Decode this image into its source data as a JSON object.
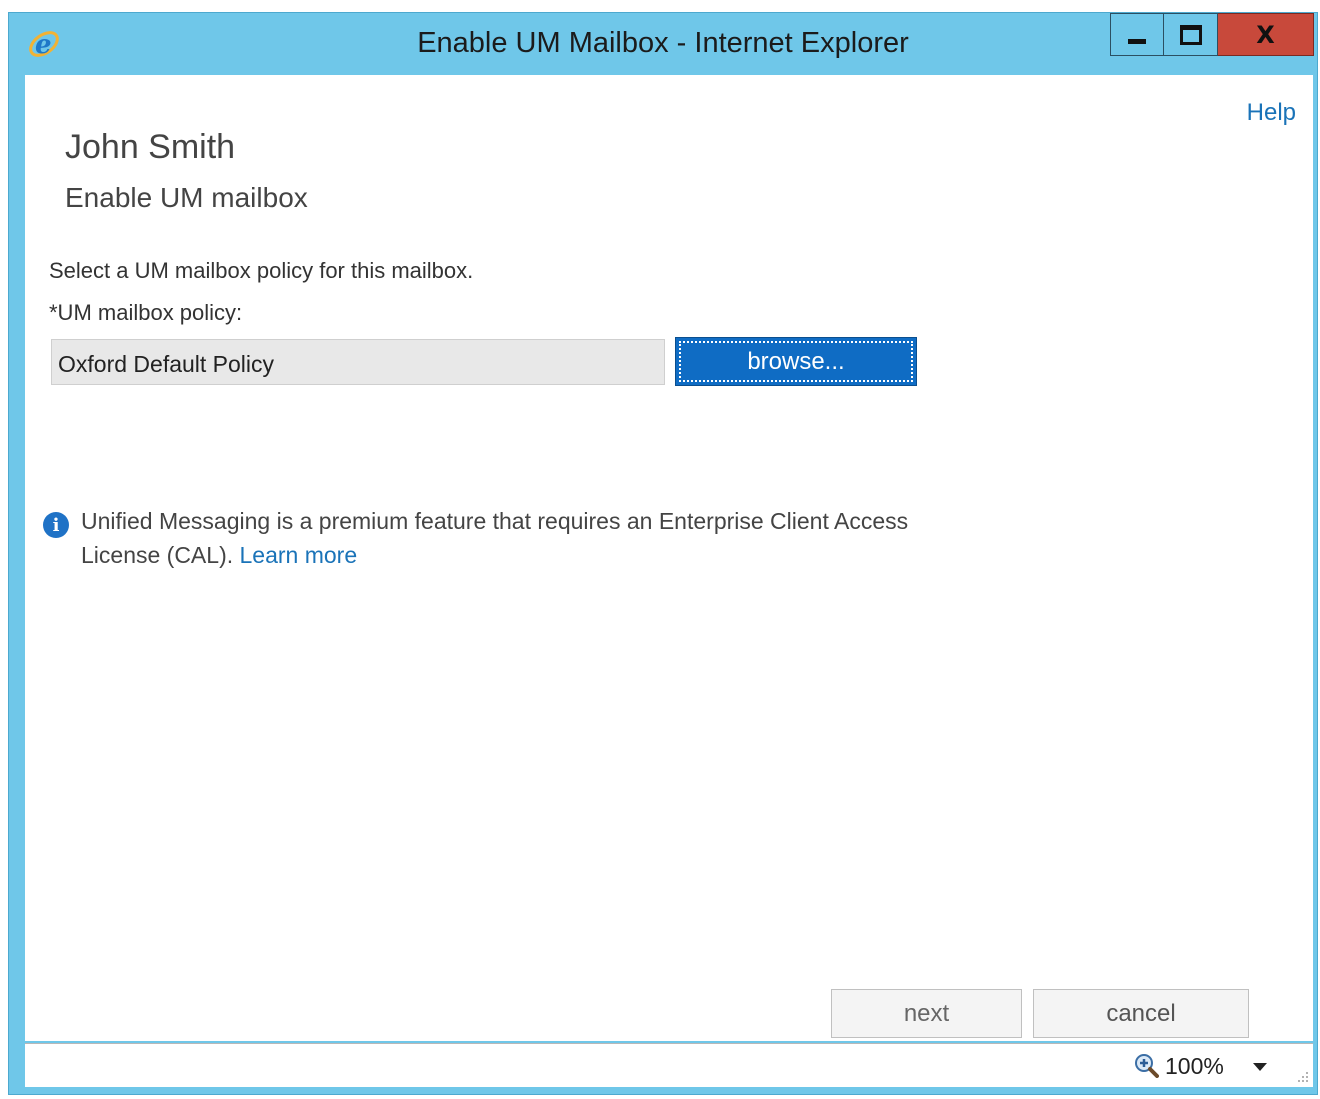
{
  "window": {
    "title": "Enable UM Mailbox - Internet Explorer",
    "controls": {
      "minimize": "minimize",
      "maximize": "maximize",
      "close": "X"
    }
  },
  "page": {
    "help_label": "Help",
    "user_name": "John Smith",
    "subtitle": "Enable UM mailbox",
    "instruction": "Select a UM mailbox policy for this mailbox.",
    "policy_label": "*UM mailbox policy:",
    "policy_value": "Oxford Default Policy",
    "browse_label": "browse...",
    "info_text": "Unified Messaging is a premium feature that requires an Enterprise Client Access License (CAL).",
    "learn_more_label": "Learn more",
    "next_label": "next",
    "cancel_label": "cancel"
  },
  "statusbar": {
    "zoom_level": "100%"
  },
  "colors": {
    "titlebar": "#6fc7e9",
    "close_button": "#c8493b",
    "accent_link": "#1a73b8",
    "primary_button": "#0f6cc4"
  },
  "icons": [
    "ie-logo-icon",
    "info-icon",
    "zoom-icon",
    "chevron-down-icon",
    "resize-grip-icon"
  ]
}
